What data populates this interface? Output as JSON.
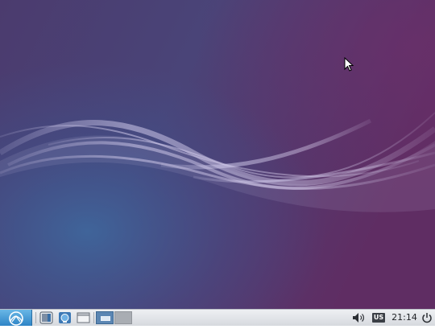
{
  "desktop": {
    "wallpaper": "lubuntu-wave",
    "colors": {
      "purple": "#5f2d63",
      "blue": "#3e5f92",
      "wave": "#c3bfe0"
    }
  },
  "cursor": {
    "icon": "arrow-pointer-icon"
  },
  "taskbar": {
    "menu_icon": "lubuntu-logo-icon",
    "launchers": [
      "file-manager-icon",
      "network-icon",
      "show-desktop-icon"
    ],
    "workspaces": [
      {
        "icon": "workspace-1",
        "active": true
      },
      {
        "icon": "workspace-2",
        "active": false
      }
    ],
    "tray": {
      "volume_icon": "speaker-volume-icon",
      "keyboard_layout": "US",
      "clock": "21:14",
      "power_icon": "power-icon"
    },
    "colors": {
      "bar": "#e4e6ea",
      "menu_button": "#3a8fd0"
    }
  }
}
